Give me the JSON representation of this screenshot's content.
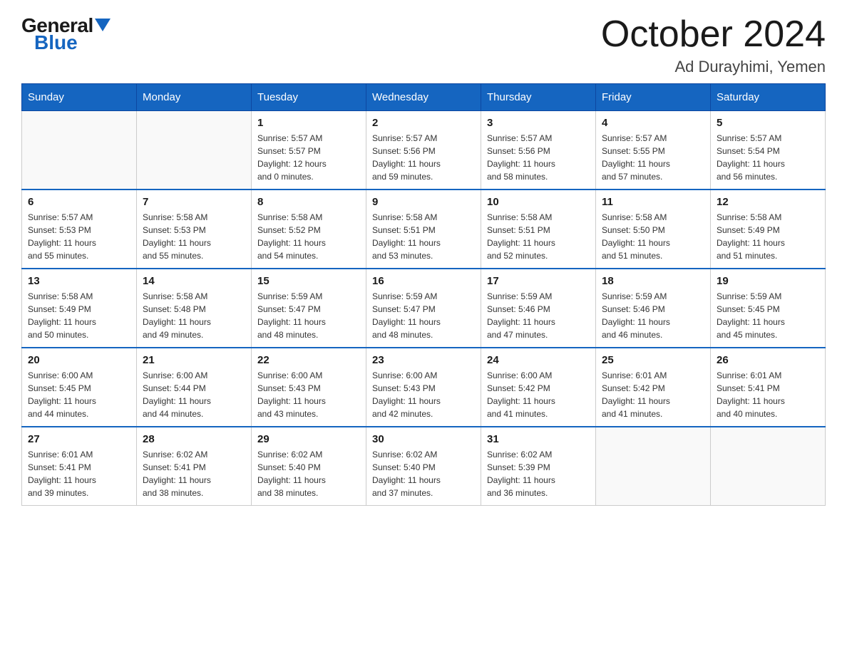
{
  "header": {
    "logo_general": "General",
    "logo_blue": "Blue",
    "main_title": "October 2024",
    "subtitle": "Ad Durayhimi, Yemen"
  },
  "days_of_week": [
    "Sunday",
    "Monday",
    "Tuesday",
    "Wednesday",
    "Thursday",
    "Friday",
    "Saturday"
  ],
  "weeks": [
    [
      {
        "day": "",
        "info": ""
      },
      {
        "day": "",
        "info": ""
      },
      {
        "day": "1",
        "info": "Sunrise: 5:57 AM\nSunset: 5:57 PM\nDaylight: 12 hours\nand 0 minutes."
      },
      {
        "day": "2",
        "info": "Sunrise: 5:57 AM\nSunset: 5:56 PM\nDaylight: 11 hours\nand 59 minutes."
      },
      {
        "day": "3",
        "info": "Sunrise: 5:57 AM\nSunset: 5:56 PM\nDaylight: 11 hours\nand 58 minutes."
      },
      {
        "day": "4",
        "info": "Sunrise: 5:57 AM\nSunset: 5:55 PM\nDaylight: 11 hours\nand 57 minutes."
      },
      {
        "day": "5",
        "info": "Sunrise: 5:57 AM\nSunset: 5:54 PM\nDaylight: 11 hours\nand 56 minutes."
      }
    ],
    [
      {
        "day": "6",
        "info": "Sunrise: 5:57 AM\nSunset: 5:53 PM\nDaylight: 11 hours\nand 55 minutes."
      },
      {
        "day": "7",
        "info": "Sunrise: 5:58 AM\nSunset: 5:53 PM\nDaylight: 11 hours\nand 55 minutes."
      },
      {
        "day": "8",
        "info": "Sunrise: 5:58 AM\nSunset: 5:52 PM\nDaylight: 11 hours\nand 54 minutes."
      },
      {
        "day": "9",
        "info": "Sunrise: 5:58 AM\nSunset: 5:51 PM\nDaylight: 11 hours\nand 53 minutes."
      },
      {
        "day": "10",
        "info": "Sunrise: 5:58 AM\nSunset: 5:51 PM\nDaylight: 11 hours\nand 52 minutes."
      },
      {
        "day": "11",
        "info": "Sunrise: 5:58 AM\nSunset: 5:50 PM\nDaylight: 11 hours\nand 51 minutes."
      },
      {
        "day": "12",
        "info": "Sunrise: 5:58 AM\nSunset: 5:49 PM\nDaylight: 11 hours\nand 51 minutes."
      }
    ],
    [
      {
        "day": "13",
        "info": "Sunrise: 5:58 AM\nSunset: 5:49 PM\nDaylight: 11 hours\nand 50 minutes."
      },
      {
        "day": "14",
        "info": "Sunrise: 5:58 AM\nSunset: 5:48 PM\nDaylight: 11 hours\nand 49 minutes."
      },
      {
        "day": "15",
        "info": "Sunrise: 5:59 AM\nSunset: 5:47 PM\nDaylight: 11 hours\nand 48 minutes."
      },
      {
        "day": "16",
        "info": "Sunrise: 5:59 AM\nSunset: 5:47 PM\nDaylight: 11 hours\nand 48 minutes."
      },
      {
        "day": "17",
        "info": "Sunrise: 5:59 AM\nSunset: 5:46 PM\nDaylight: 11 hours\nand 47 minutes."
      },
      {
        "day": "18",
        "info": "Sunrise: 5:59 AM\nSunset: 5:46 PM\nDaylight: 11 hours\nand 46 minutes."
      },
      {
        "day": "19",
        "info": "Sunrise: 5:59 AM\nSunset: 5:45 PM\nDaylight: 11 hours\nand 45 minutes."
      }
    ],
    [
      {
        "day": "20",
        "info": "Sunrise: 6:00 AM\nSunset: 5:45 PM\nDaylight: 11 hours\nand 44 minutes."
      },
      {
        "day": "21",
        "info": "Sunrise: 6:00 AM\nSunset: 5:44 PM\nDaylight: 11 hours\nand 44 minutes."
      },
      {
        "day": "22",
        "info": "Sunrise: 6:00 AM\nSunset: 5:43 PM\nDaylight: 11 hours\nand 43 minutes."
      },
      {
        "day": "23",
        "info": "Sunrise: 6:00 AM\nSunset: 5:43 PM\nDaylight: 11 hours\nand 42 minutes."
      },
      {
        "day": "24",
        "info": "Sunrise: 6:00 AM\nSunset: 5:42 PM\nDaylight: 11 hours\nand 41 minutes."
      },
      {
        "day": "25",
        "info": "Sunrise: 6:01 AM\nSunset: 5:42 PM\nDaylight: 11 hours\nand 41 minutes."
      },
      {
        "day": "26",
        "info": "Sunrise: 6:01 AM\nSunset: 5:41 PM\nDaylight: 11 hours\nand 40 minutes."
      }
    ],
    [
      {
        "day": "27",
        "info": "Sunrise: 6:01 AM\nSunset: 5:41 PM\nDaylight: 11 hours\nand 39 minutes."
      },
      {
        "day": "28",
        "info": "Sunrise: 6:02 AM\nSunset: 5:41 PM\nDaylight: 11 hours\nand 38 minutes."
      },
      {
        "day": "29",
        "info": "Sunrise: 6:02 AM\nSunset: 5:40 PM\nDaylight: 11 hours\nand 38 minutes."
      },
      {
        "day": "30",
        "info": "Sunrise: 6:02 AM\nSunset: 5:40 PM\nDaylight: 11 hours\nand 37 minutes."
      },
      {
        "day": "31",
        "info": "Sunrise: 6:02 AM\nSunset: 5:39 PM\nDaylight: 11 hours\nand 36 minutes."
      },
      {
        "day": "",
        "info": ""
      },
      {
        "day": "",
        "info": ""
      }
    ]
  ]
}
